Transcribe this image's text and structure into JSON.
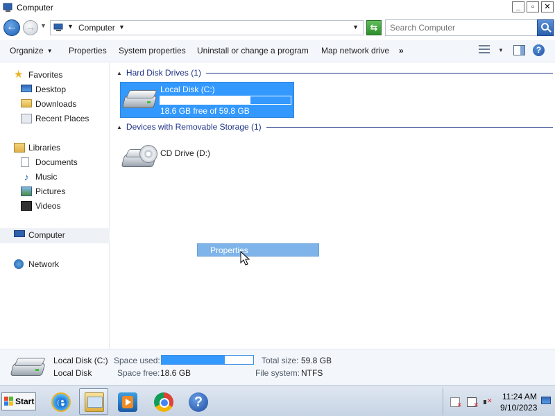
{
  "window": {
    "title": "Computer"
  },
  "titlebar_buttons": {
    "minimize": "_",
    "maximize": "▫",
    "close": "✕"
  },
  "address": {
    "crumb": "Computer",
    "search_placeholder": "Search Computer"
  },
  "commandbar": {
    "organize": "Organize",
    "properties": "Properties",
    "system_properties": "System properties",
    "uninstall": "Uninstall or change a program",
    "map_drive": "Map network drive",
    "more": "»"
  },
  "nav": {
    "favorites": "Favorites",
    "desktop": "Desktop",
    "downloads": "Downloads",
    "recent": "Recent Places",
    "libraries": "Libraries",
    "documents": "Documents",
    "music": "Music",
    "pictures": "Pictures",
    "videos": "Videos",
    "computer": "Computer",
    "network": "Network"
  },
  "content": {
    "hdd_group": "Hard Disk Drives (1)",
    "removable_group": "Devices with Removable Storage (1)",
    "local_disk": {
      "name": "Local Disk (C:)",
      "free_text": "18.6 GB free of 59.8 GB",
      "used_fraction": 0.69
    },
    "cd_drive": {
      "name": "CD Drive (D:)"
    }
  },
  "context_menu": {
    "item": "Properties"
  },
  "details": {
    "name": "Local Disk (C:)",
    "type": "Local Disk",
    "space_used_label": "Space used:",
    "space_free_label": "Space free:",
    "space_free_value": "18.6 GB",
    "total_size_label": "Total size:",
    "total_size_value": "59.8 GB",
    "fs_label": "File system:",
    "fs_value": "NTFS",
    "used_fraction": 0.69
  },
  "taskbar": {
    "start": "Start",
    "time": "11:24 AM",
    "date": "9/10/2023"
  },
  "colors": {
    "selection": "#3399ff",
    "group_header": "#1e3287",
    "context_menu": "#7eb4ea"
  },
  "icons": {
    "back": "back-arrow-icon",
    "forward": "forward-arrow-icon",
    "search": "search-icon",
    "help": "help-icon",
    "drive": "hard-drive-icon",
    "cd": "cd-drive-icon"
  }
}
